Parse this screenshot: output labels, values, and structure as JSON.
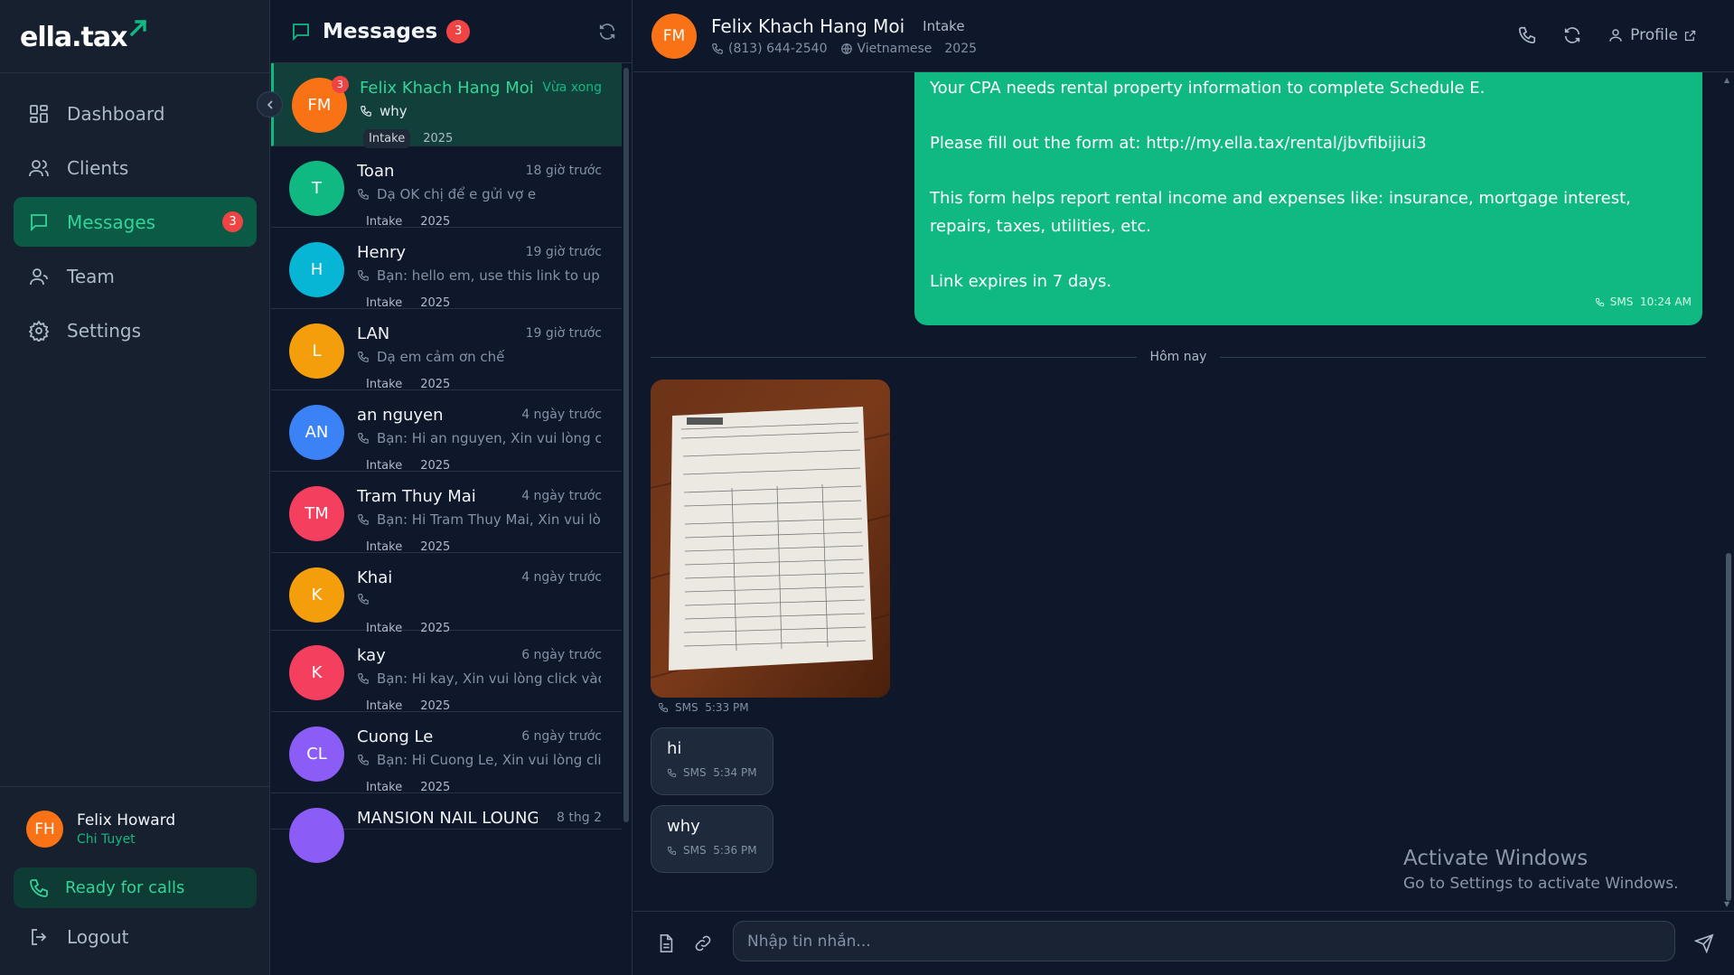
{
  "app": {
    "logo_text": "ella.tax"
  },
  "sidebar": {
    "nav": [
      {
        "label": "Dashboard",
        "icon": "dashboard-icon"
      },
      {
        "label": "Clients",
        "icon": "users-icon"
      },
      {
        "label": "Messages",
        "icon": "message-icon",
        "badge": "3",
        "active": true
      },
      {
        "label": "Team",
        "icon": "user-icon"
      },
      {
        "label": "Settings",
        "icon": "gear-icon"
      }
    ],
    "user": {
      "initials": "FH",
      "name": "Felix Howard",
      "role": "Chi Tuyet"
    },
    "ready_label": "Ready for calls",
    "logout_label": "Logout"
  },
  "conversations": {
    "title": "Messages",
    "count": "3",
    "items": [
      {
        "initials": "FM",
        "name": "Felix Khach Hang Moi",
        "time": "Vừa xong",
        "preview": "why",
        "tag": "Intake",
        "year": "2025",
        "color": "#f97316",
        "badge": "3",
        "active": true
      },
      {
        "initials": "T",
        "name": "Toan",
        "time": "18 giờ trước",
        "preview": "Dạ OK chị để e gửi vợ e",
        "tag": "Intake",
        "year": "2025",
        "color": "#10b981"
      },
      {
        "initials": "H",
        "name": "Henry",
        "time": "19 giờ trước",
        "preview": "Bạn: hello em, use this link to uplo...",
        "tag": "Intake",
        "year": "2025",
        "color": "#06b6d4"
      },
      {
        "initials": "L",
        "name": "LAN",
        "time": "19 giờ trước",
        "preview": "Dạ em cảm ơn chế",
        "tag": "Intake",
        "year": "2025",
        "color": "#f59e0b"
      },
      {
        "initials": "AN",
        "name": "an nguyen",
        "time": "4 ngày trước",
        "preview": "Bạn: Hi an nguyen, Xin vui lòng clic...",
        "tag": "Intake",
        "year": "2025",
        "color": "#3b82f6"
      },
      {
        "initials": "TM",
        "name": "Tram Thuy Mai",
        "time": "4 ngày trước",
        "preview": "Bạn: Hi Tram Thuy Mai, Xin vui lòn...",
        "tag": "Intake",
        "year": "2025",
        "color": "#f43f5e"
      },
      {
        "initials": "K",
        "name": "Khai",
        "time": "4 ngày trước",
        "preview": "",
        "tag": "Intake",
        "year": "2025",
        "color": "#f59e0b"
      },
      {
        "initials": "K",
        "name": "kay",
        "time": "6 ngày trước",
        "preview": "Bạn: Hi kay, Xin vui lòng click vào li...",
        "tag": "Intake",
        "year": "2025",
        "color": "#f43f5e"
      },
      {
        "initials": "CL",
        "name": "Cuong Le",
        "time": "6 ngày trước",
        "preview": "Bạn: Hi Cuong Le, Xin vui lòng click...",
        "tag": "Intake",
        "year": "2025",
        "color": "#8b5cf6"
      },
      {
        "initials": "",
        "name": "MANSION NAIL LOUNGE",
        "time": "8 thg 2",
        "preview": "",
        "tag": "",
        "year": "",
        "color": "#8b5cf6"
      }
    ]
  },
  "chat": {
    "contact": {
      "initials": "FM",
      "name": "Felix Khach Hang Moi",
      "stage": "Intake",
      "phone": "(813) 644-2540",
      "language": "Vietnamese",
      "year": "2025"
    },
    "profile_label": "Profile",
    "outgoing": {
      "line1": "Your CPA needs rental property information to complete Schedule E.",
      "line2": "Please fill out the form at: http://my.ella.tax/rental/jbvfibijiui3",
      "line3": "This form helps report rental income and expenses like: insurance, mortgage interest, repairs, taxes, utilities, etc.",
      "line4": "Link expires in 7 days.",
      "channel": "SMS",
      "time": "10:24 AM"
    },
    "date_divider": "Hôm nay",
    "image_message": {
      "channel": "SMS",
      "time": "5:33 PM"
    },
    "messages": [
      {
        "text": "hi",
        "channel": "SMS",
        "time": "5:34 PM"
      },
      {
        "text": "why",
        "channel": "SMS",
        "time": "5:36 PM"
      }
    ],
    "input_placeholder": "Nhập tin nhắn..."
  },
  "watermark": {
    "title": "Activate Windows",
    "subtitle": "Go to Settings to activate Windows."
  }
}
